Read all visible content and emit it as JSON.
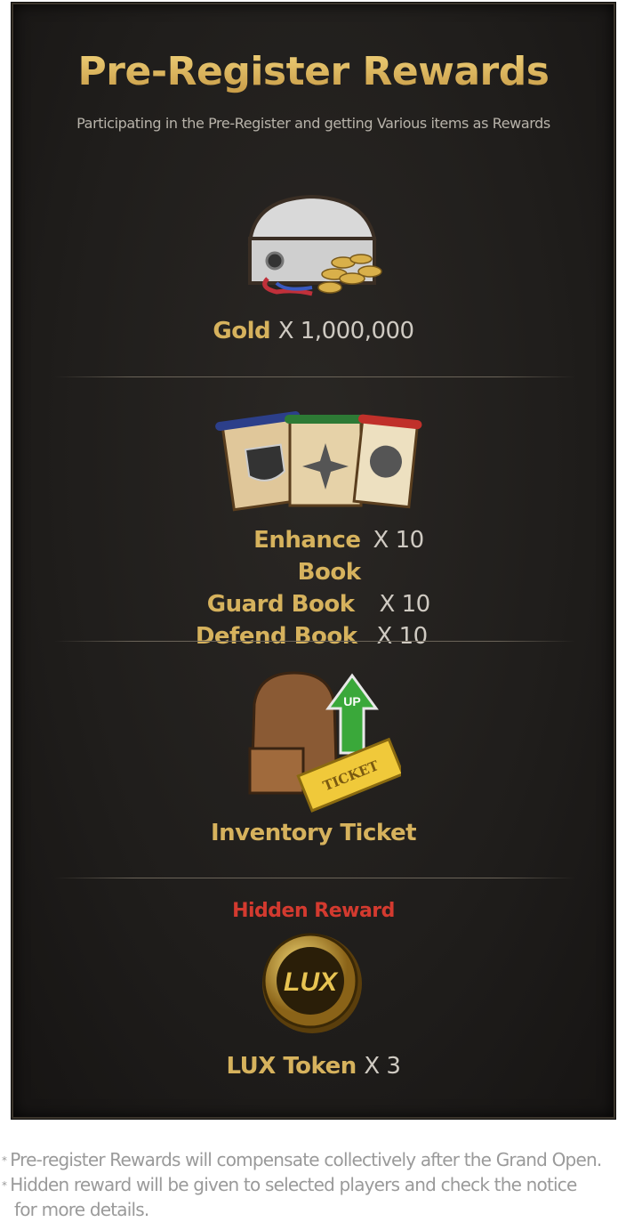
{
  "header": {
    "title": "Pre-Register Rewards",
    "subtitle": "Participating in the Pre-Register and getting Various items as Rewards"
  },
  "rewards": {
    "gold": {
      "name": "Gold",
      "qty": "X 1,000,000",
      "icon": "treasure-chest-icon"
    },
    "books": [
      {
        "name": "Enhance Book",
        "qty": "X 10"
      },
      {
        "name": "Guard Book",
        "qty": "X 10"
      },
      {
        "name": "Defend Book",
        "qty": "X 10"
      }
    ],
    "inventory": {
      "name": "Inventory Ticket",
      "icon": "backpack-ticket-icon",
      "icon_text_up": "UP",
      "icon_text_ticket": "TICKET"
    },
    "hidden": {
      "heading": "Hidden Reward",
      "name": "LUX Token",
      "qty": "X 3",
      "icon": "lux-coin-icon",
      "coin_text": "LUX"
    }
  },
  "notes": {
    "bullet": "*",
    "line1": "Pre-register Rewards will compensate collectively after the Grand Open.",
    "line2": "Hidden reward will be given to selected players and check the notice",
    "line3": "for more details."
  },
  "colors": {
    "gold": "#d6b25d",
    "hidden": "#d33a2f",
    "panel": "#1f1d1b"
  }
}
